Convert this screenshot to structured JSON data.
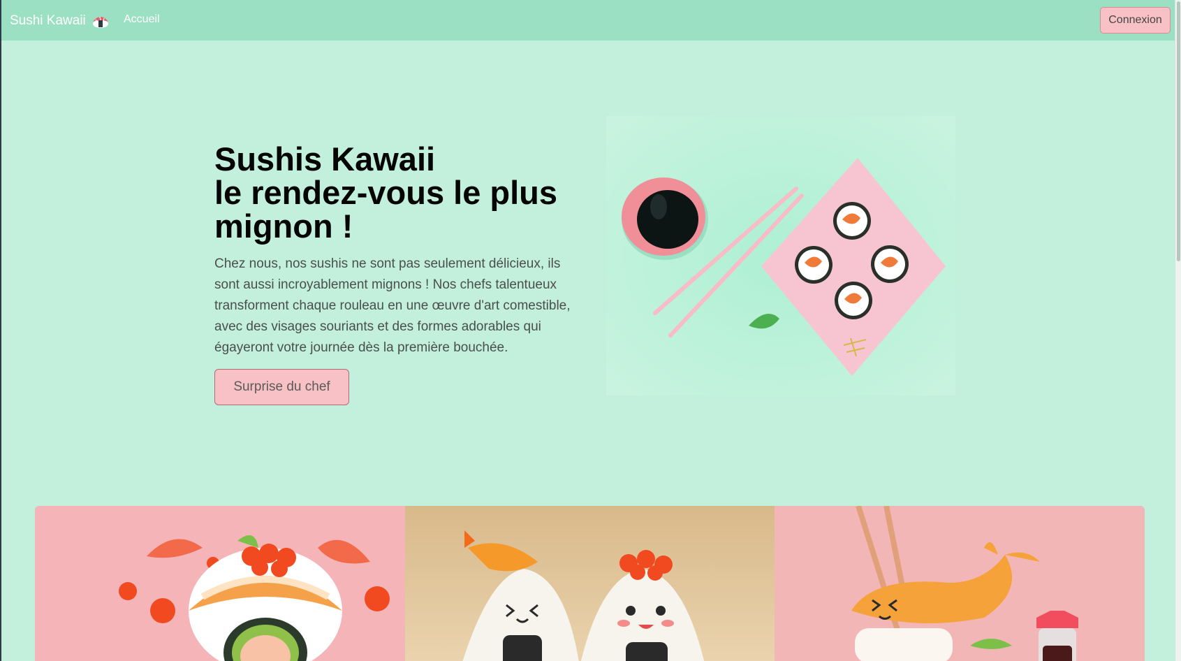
{
  "navbar": {
    "brand": "Sushi Kawaii",
    "brand_icon": "sushi-icon",
    "links": [
      "Accueil"
    ],
    "login_label": "Connexion"
  },
  "hero": {
    "title_line1": "Sushis Kawaii",
    "title_line2": "le rendez-vous le plus mignon !",
    "text": "Chez nous, nos sushis ne sont pas seulement délicieux, ils sont aussi incroyablement mignons ! Nos chefs talentueux transforment chaque rouleau en une œuvre d'art comestible, avec des visages souriants et des formes adorables qui égayeront votre journée dès la première bouchée.",
    "cta_label": "Surprise du chef"
  },
  "gallery": {
    "images": [
      "salmon-roll-hamster",
      "onigiri-duo",
      "shrimp-nigiri-chopsticks"
    ]
  },
  "colors": {
    "navbar": "#9ce0c3",
    "background": "#c2f0dc",
    "button": "#f8c1c6"
  }
}
